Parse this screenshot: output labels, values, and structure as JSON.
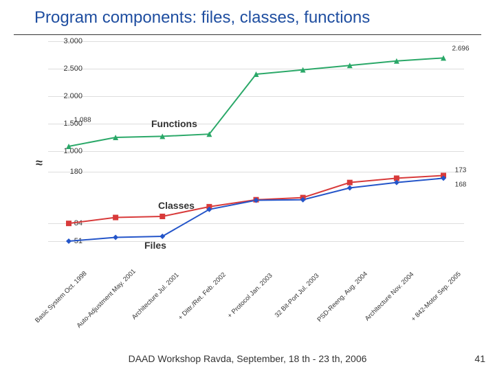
{
  "title": "Program components: files, classes, functions",
  "footer": "DAAD Workshop Ravda, September, 18 th - 23 th, 2006",
  "page_number": "41",
  "chart_data": {
    "type": "line",
    "categories": [
      "Basic System\nOct. 1998",
      "Auto-Adjustment\nMay. 2001",
      "Architecture\nJul. 2001",
      "+ Dittr./Ret.\nFeb. 2002",
      "+ Protocol\nJan. 2003",
      "32 Bit-Port\nJul. 2003",
      "PSD-Reeng.\nAug. 2004",
      "Architecture\nNov. 2004",
      "+ 842-Motor\nSep. 2005"
    ],
    "series": [
      {
        "name": "Functions",
        "color": "#2aa868",
        "values": [
          1088,
          1250,
          1270,
          1310,
          2400,
          2480,
          2560,
          2640,
          2696
        ]
      },
      {
        "name": "Classes",
        "color": "#d83a3a",
        "values": [
          84,
          95,
          97,
          115,
          128,
          132,
          160,
          168,
          173
        ]
      },
      {
        "name": "Files",
        "color": "#2455c9",
        "values": [
          51,
          58,
          60,
          110,
          127,
          128,
          150,
          160,
          168
        ]
      }
    ],
    "upper_ticks": [
      3000,
      2500,
      2000,
      1500,
      1000
    ],
    "lower_ticks": [
      180,
      84,
      51
    ],
    "labeled_points": {
      "Functions_first": "1.088",
      "Functions_last": "2.696",
      "Classes_first": "84",
      "Classes_last": "173",
      "Files_first": "51",
      "Files_last": "168"
    }
  }
}
